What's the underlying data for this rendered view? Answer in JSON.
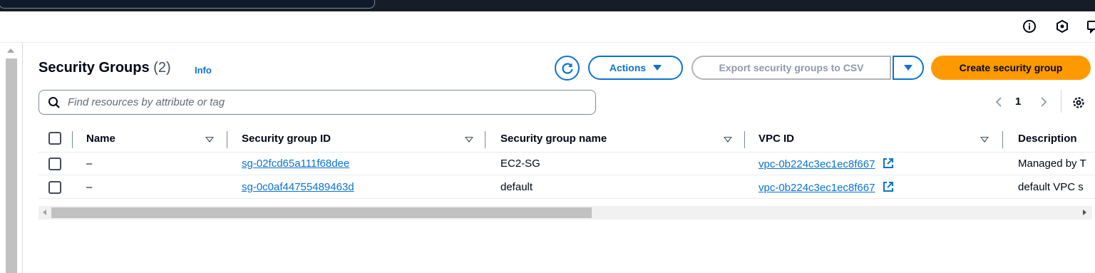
{
  "colors": {
    "topbar": "#161d26",
    "link": "#0972d3",
    "primary_button": "#ff9900",
    "text": "#000716",
    "disabled": "#8d99a8"
  },
  "utility_icons": [
    "info-circle-icon",
    "settings-hexagon-icon",
    "feedback-icon"
  ],
  "header": {
    "title": "Security Groups",
    "count": "(2)",
    "info": "Info"
  },
  "toolbar": {
    "refresh_icon": "refresh-icon",
    "actions_label": "Actions",
    "export_label": "Export security groups to CSV",
    "create_label": "Create security group"
  },
  "search": {
    "placeholder": "Find resources by attribute or tag",
    "value": ""
  },
  "pagination": {
    "current_page": "1"
  },
  "table": {
    "columns": [
      "Name",
      "Security group ID",
      "Security group name",
      "VPC ID",
      "Description"
    ],
    "rows": [
      {
        "name": "–",
        "sg_id": "sg-02fcd65a111f68dee",
        "sg_name": "EC2-SG",
        "vpc_id": "vpc-0b224c3ec1ec8f667",
        "description": "Managed by T"
      },
      {
        "name": "–",
        "sg_id": "sg-0c0af44755489463d",
        "sg_name": "default",
        "vpc_id": "vpc-0b224c3ec1ec8f667",
        "description": "default VPC s"
      }
    ]
  }
}
